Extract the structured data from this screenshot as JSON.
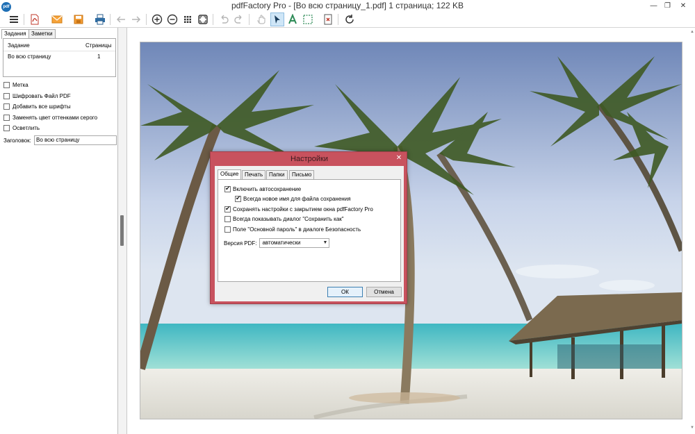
{
  "window": {
    "app_icon_text": "pdf",
    "title": "pdfFactory Pro - [Во всю страницу_1.pdf] 1 страница; 122 KB",
    "minimize": "—",
    "maximize": "❐",
    "close": "✕"
  },
  "toolbar": {
    "items": [
      {
        "name": "menu-icon"
      },
      {
        "name": "pdf-file-icon"
      },
      {
        "name": "email-icon"
      },
      {
        "name": "save-icon"
      },
      {
        "name": "print-icon"
      },
      {
        "name": "back-arrow-icon"
      },
      {
        "name": "forward-arrow-icon"
      },
      {
        "name": "zoom-in-icon"
      },
      {
        "name": "zoom-out-icon"
      },
      {
        "name": "thumbnails-grid-icon"
      },
      {
        "name": "fit-page-icon"
      },
      {
        "name": "undo-icon"
      },
      {
        "name": "redo-icon"
      },
      {
        "name": "hand-tool-icon"
      },
      {
        "name": "select-arrow-icon"
      },
      {
        "name": "text-tool-icon"
      },
      {
        "name": "marquee-select-icon"
      },
      {
        "name": "delete-page-icon"
      },
      {
        "name": "refresh-icon"
      }
    ]
  },
  "left_panel": {
    "tabs": [
      "Задания",
      "Заметки"
    ],
    "jobs_table": {
      "columns": [
        "Задание",
        "Страницы"
      ],
      "rows": [
        [
          "Во всю страницу",
          "1"
        ]
      ]
    },
    "options": [
      "Метка",
      "Шифровать Файл PDF",
      "Добавить все шрифты",
      "Заменять цвет оттенками серого",
      "Осветлить"
    ],
    "header_label": "Заголовок:",
    "header_value": "Во всю страницу"
  },
  "dialog": {
    "title": "Настройки",
    "close": "✕",
    "tabs": [
      "Общие",
      "Печать",
      "Папки",
      "Письмо"
    ],
    "options": [
      {
        "label": "Включить автосохранение",
        "checked": true
      },
      {
        "label": "Всегда новое имя для файла сохранения",
        "checked": true
      },
      {
        "label": "Сохранять настройки с закрытием окна pdfFactory Pro",
        "checked": true
      },
      {
        "label": "Всегда показывать диалог \"Сохранить как\"",
        "checked": false
      },
      {
        "label": "Поле \"Основной пароль\" в диалоге Безопасность",
        "checked": false
      }
    ],
    "pdf_version_label": "Версия PDF:",
    "pdf_version_value": "автоматически",
    "ok_label": "ОК",
    "cancel_label": "Отмена"
  },
  "colors": {
    "dialog_frame": "#c8525e",
    "accent": "#1e6fb5"
  }
}
